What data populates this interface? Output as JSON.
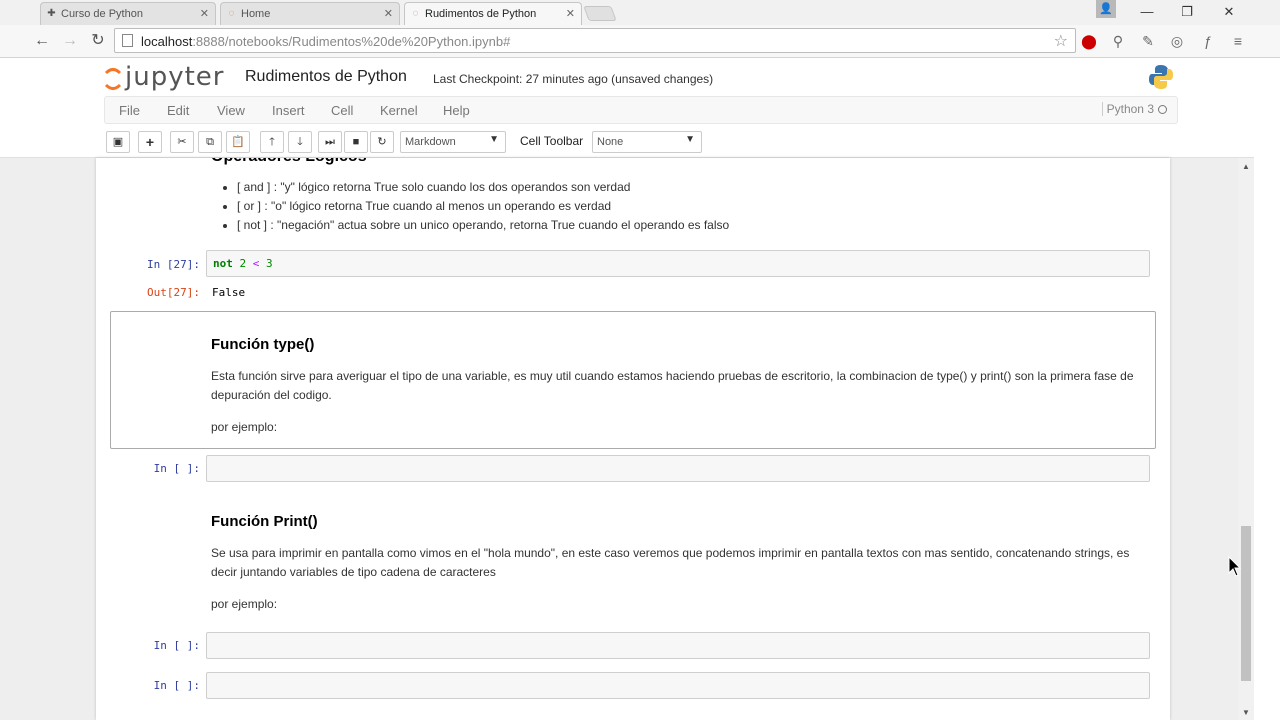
{
  "browser": {
    "tabs": [
      {
        "label": "Curso de Python",
        "icon": "puzzle-icon"
      },
      {
        "label": "Home",
        "icon": "jupyter-icon"
      },
      {
        "label": "Rudimentos de Python",
        "icon": "jupyter-icon"
      }
    ],
    "url_host": "localhost",
    "url_rest": ":8888/notebooks/Rudimentos%20de%20Python.ipynb#"
  },
  "header": {
    "logo_text": "jupyter",
    "notebook_title": "Rudimentos de Python",
    "checkpoint": "Last Checkpoint: 27 minutes ago (unsaved changes)"
  },
  "menu": {
    "items": [
      "File",
      "Edit",
      "View",
      "Insert",
      "Cell",
      "Kernel",
      "Help"
    ],
    "kernel": "Python 3"
  },
  "toolbar": {
    "cell_type": "Markdown",
    "cell_toolbar_label": "Cell Toolbar",
    "cell_toolbar_value": "None"
  },
  "notebook": {
    "cut_heading": "Operadores Logicos",
    "logic_list": [
      "[ and ] : \"y\" lógico retorna True solo cuando los dos operandos son verdad",
      "[ or ] : \"o\" lógico retorna True cuando al menos un operando es verdad",
      "[ not ] : \"negación\" actua sobre un unico operando, retorna True cuando el operando es falso"
    ],
    "cell27": {
      "in_prompt": "In [27]:",
      "code_kw": "not",
      "code_a": "2",
      "code_op": "<",
      "code_b": "3",
      "out_prompt": "Out[27]:",
      "output": "False"
    },
    "type_cell": {
      "heading": "Función type()",
      "para": "Esta función sirve para averiguar el tipo de una variable, es muy util cuando estamos haciendo pruebas de escritorio, la combinacion de type() y print() son la primera fase de depuración del codigo.",
      "example": "por ejemplo:"
    },
    "empty_prompt": "In [ ]:",
    "print_cell": {
      "heading": "Función Print()",
      "para": "Se usa para imprimir en pantalla como vimos en el \"hola mundo\", en este caso veremos que podemos imprimir en pantalla textos con mas sentido, concatenando strings, es decir juntando variables de tipo cadena de caracteres",
      "example": "por ejemplo:"
    }
  }
}
